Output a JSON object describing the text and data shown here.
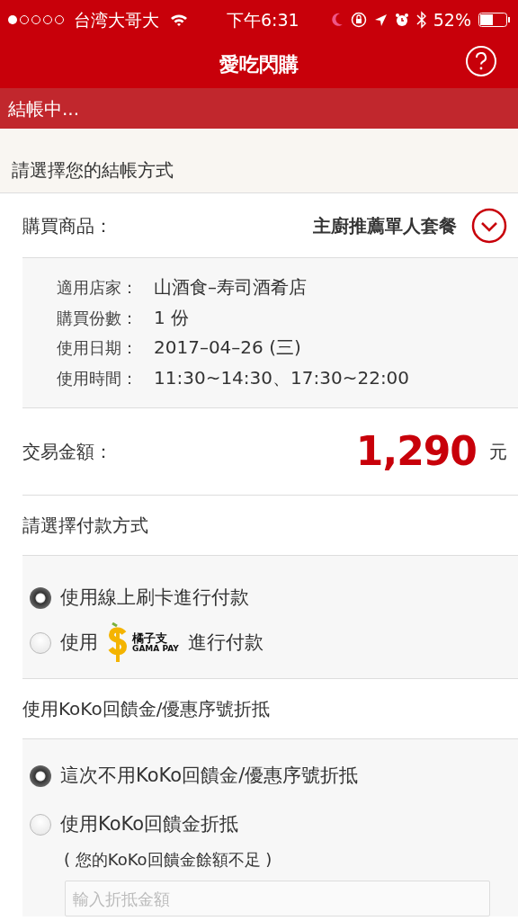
{
  "status_bar": {
    "carrier": "台湾大哥大",
    "time": "下午6:31",
    "battery": "52%"
  },
  "nav": {
    "title": "愛吃閃購"
  },
  "progress_banner": "結帳中...",
  "section_heading": "請選擇您的結帳方式",
  "product": {
    "label": "購買商品：",
    "value": "主廚推薦單人套餐"
  },
  "details": [
    {
      "label": "適用店家：",
      "value": "山酒食–寿司酒肴店"
    },
    {
      "label": "購買份數：",
      "value": "1 份"
    },
    {
      "label": "使用日期：",
      "value": "2017–04–26 (三)"
    },
    {
      "label": "使用時間：",
      "value": "11:30~14:30、17:30~22:00"
    }
  ],
  "amount": {
    "label": "交易金額：",
    "value": "1,290",
    "unit": "元"
  },
  "payment": {
    "heading": "請選擇付款方式",
    "options": [
      {
        "kind": "text",
        "label": "使用線上刷卡進行付款",
        "selected": true
      },
      {
        "kind": "logo",
        "prefix": "使用",
        "logo_title": "橘子支",
        "logo_subtitle": "GAMA PAY",
        "suffix": "進行付款",
        "selected": false
      }
    ]
  },
  "discount": {
    "heading": "使用KoKo回饋金/優惠序號折抵",
    "options": [
      {
        "label": "這次不用KoKo回饋金/優惠序號折抵",
        "selected": true
      },
      {
        "label": "使用KoKo回饋金折抵",
        "note": "( 您的KoKo回饋金餘額不足 )",
        "selected": false
      }
    ],
    "amount_field": {
      "placeholder": "輸入折抵金額"
    }
  }
}
